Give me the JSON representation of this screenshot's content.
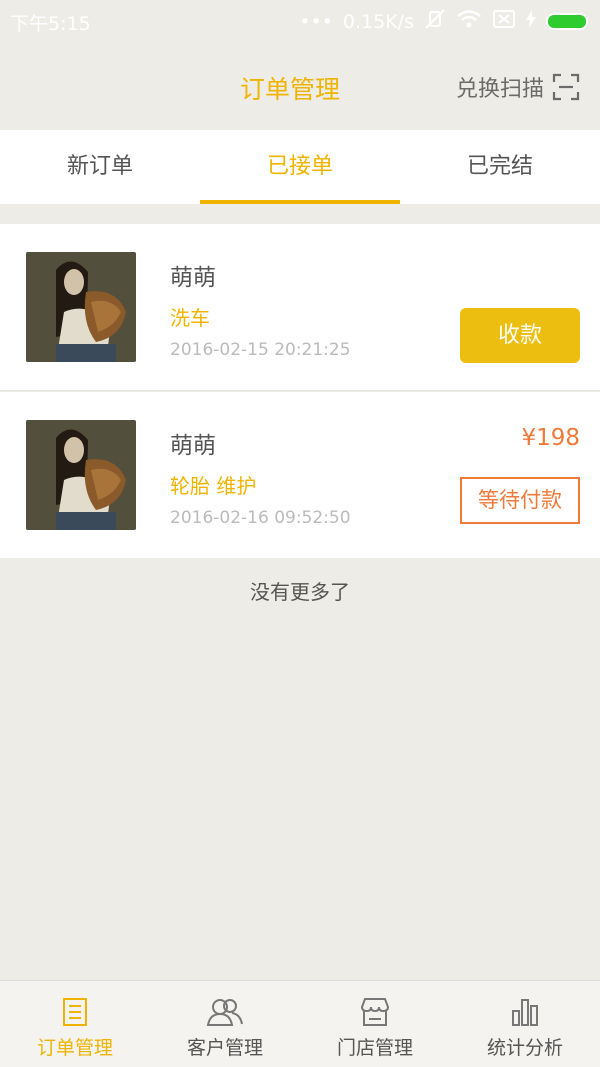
{
  "status_bar": {
    "time": "下午5:15",
    "network_speed": "0.15K/s"
  },
  "header": {
    "title": "订单管理",
    "scan_label": "兑换扫描"
  },
  "tabs": [
    {
      "label": "新订单",
      "active": false
    },
    {
      "label": "已接单",
      "active": true
    },
    {
      "label": "已完结",
      "active": false
    }
  ],
  "orders": [
    {
      "name": "萌萌",
      "service": "洗车",
      "time": "2016-02-15 20:21:25",
      "action_label": "收款"
    },
    {
      "name": "萌萌",
      "service": "轮胎 维护",
      "time": "2016-02-16 09:52:50",
      "price": "¥198",
      "status_label": "等待付款"
    }
  ],
  "footer_text": "没有更多了",
  "bottom_nav": [
    {
      "label": "订单管理",
      "icon": "list-icon",
      "active": true
    },
    {
      "label": "客户管理",
      "icon": "users-icon",
      "active": false
    },
    {
      "label": "门店管理",
      "icon": "store-icon",
      "active": false
    },
    {
      "label": "统计分析",
      "icon": "bar-chart-icon",
      "active": false
    }
  ],
  "colors": {
    "accent": "#f0b400",
    "price": "#f07a3a",
    "button": "#ecbe10"
  }
}
